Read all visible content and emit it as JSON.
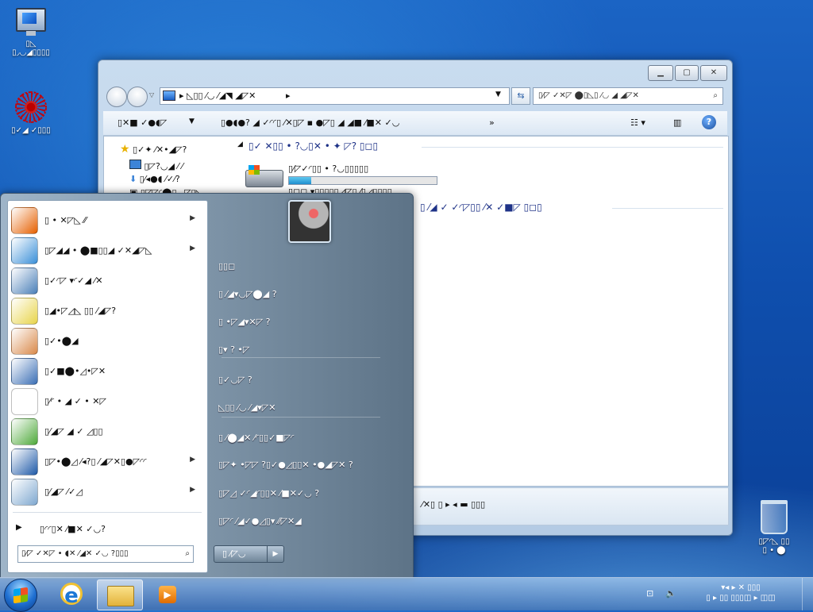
{
  "desktop": {
    "computer_label": [
      "▯◺",
      "▯◞◡◢▯▯▯▯"
    ],
    "shortcut_label": "▯✓◢ ✓▯▯▯",
    "recycle_label": [
      "▯◸◜◺ ▯▯",
      "▯ • ⬤"
    ]
  },
  "explorer": {
    "breadcrumb": "▸ ◺▯▯ ⁄◡ ⁄◢◥ ◢◸✕",
    "search_placeholder": "▯⁄◸ ✓✕◸ ⬤▯◺▯ ⁄◡ ◢ ◢◸✕",
    "toolbar": {
      "organize": "▯✕■ ✓●◖◸",
      "properties": "▯●◖●? ◢ ✓◜◜▯ ⁄✕▯◸ ▪ ●◸▯ ◢ ◢■ ⁄■✕ ✓◡",
      "more": "»"
    },
    "nav_tree": {
      "favorites": "▯✓✦ ⁄✕•◢◸?",
      "desktop": "▯◸?◡◢ ⁄ ⁄",
      "downloads": "▯⁄◂●◖ ⁄✓⁄?",
      "recent": "▯◸◸◜⬤▯◡◸▯◺"
    },
    "hdd_section": "▯✓ ✕▯▯ • ?◡▯✕ • ✦ ◸? ▯◻▯",
    "hdd_name": "▯⁄◸✓◜▯▯ • ?◡▯▯▯▯▯",
    "hdd_free": "▯◻◻ ▾▯▯▯▯▯◿◸▯ ⁄▯◿▯▯▯▯",
    "hdd_fill": 0.15,
    "other_section": "▯ ⁄◢ ✓ ✓◜◸▯▯ ⁄✕ ✓■◸ ▯◻▯",
    "status_text": "⁄✕▯ ▯ ▸ ◂ ▬ ▯▯▯"
  },
  "start_menu": {
    "programs": [
      {
        "label": "▯ • ✕◸◺ ⁄⁄",
        "arrow": true,
        "icon": "firefox-icon",
        "color": "#e66000"
      },
      {
        "label": "▯◸◢◢ • ⬤■▯▯◢ ✓✕◢◸◺",
        "arrow": true,
        "icon": "network-icon",
        "color": "#3a8fd8"
      },
      {
        "label": "▯✓◜◸ ▾◜✓◢ ⁄✕",
        "arrow": false,
        "icon": "calculator-icon",
        "color": "#4a7fb8"
      },
      {
        "label": "▯◢•◸◿◺ ▯▯ ⁄◢◸?",
        "arrow": false,
        "icon": "sticky-notes-icon",
        "color": "#e8d44a"
      },
      {
        "label": "▯✓•⬤◢",
        "arrow": false,
        "icon": "paint-icon",
        "color": "#d9894a"
      },
      {
        "label": "▯✓■⬤•◿•◸✕",
        "arrow": false,
        "icon": "magnifier-icon",
        "color": "#3b6fb5"
      },
      {
        "label": "▯⁄◜ • ◢ ✓ • ✕◸",
        "arrow": false,
        "icon": "solitaire-icon",
        "color": "#ffffff"
      },
      {
        "label": "▯⁄◢◸ ◢ ✓ ◿▯▯",
        "arrow": false,
        "icon": "notepad-editor-icon",
        "color": "#4ea93a"
      },
      {
        "label": "▯◸•⬤◿ ⁄◂?▯ ⁄◢◸✕▯●◸◜◜",
        "arrow": true,
        "icon": "powershell-icon",
        "color": "#1f5aa8"
      },
      {
        "label": "▯⁄◢◸ ⁄✓◿",
        "arrow": true,
        "icon": "notepad-icon",
        "color": "#7fa8d0"
      }
    ],
    "all_programs": "▯◜◜▯✕ ⁄■✕ ✓◡?",
    "search_placeholder": "▯⁄◸ ✓✕◸ • ◖✕ ⁄◢✕ ✓◡ ?▯▯▯",
    "right_items": [
      "▯▯◻",
      "▯ ⁄◢▾◡◸⬤◢ ?",
      "▯ •◸◢▾✕◸ ?",
      "▯▾ ? •◸",
      "▯✓◡◸ ?",
      "◺▯▯ ⁄◡ ⁄◢▾◸✕",
      "▯ ⁄⬤◢✕ ⁄◜▯▯✓■◸◜",
      "▯◸✦ •◸◸ ?▯✓●◿▯▯✕ •●◢◸✕ ?",
      "▯◸◿ ✓◜◢◜▯▯✕ ⁄■✕✓◡ ?",
      "▯◸◜ ⁄◢✓●◿▯▾ ⁄⁄◸✕◢"
    ],
    "shutdown_label": "▯ ⁄◸◡"
  },
  "tray": {
    "time": "▾◂ ▸ ✕ ▯▯▯",
    "date": "▯ ▸ ▯▯ ▯▯▯◫ ▸ ◫◫"
  }
}
